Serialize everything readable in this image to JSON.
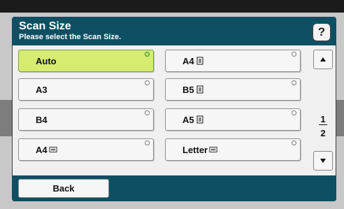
{
  "dialog": {
    "title": "Scan Size",
    "subtitle": "Please select the Scan Size."
  },
  "help_label": "?",
  "options": [
    {
      "label": "Auto",
      "selected": true,
      "icon": ""
    },
    {
      "label": "A4",
      "selected": false,
      "icon": "portrait-document-icon"
    },
    {
      "label": "A3",
      "selected": false,
      "icon": ""
    },
    {
      "label": "B5",
      "selected": false,
      "icon": "portrait-document-icon"
    },
    {
      "label": "B4",
      "selected": false,
      "icon": ""
    },
    {
      "label": "A5",
      "selected": false,
      "icon": "portrait-document-icon"
    },
    {
      "label": "A4",
      "selected": false,
      "icon": "landscape-document-icon"
    },
    {
      "label": "Letter",
      "selected": false,
      "icon": "landscape-document-icon"
    }
  ],
  "pagination": {
    "current": "1",
    "total": "2"
  },
  "footer": {
    "back_label": "Back"
  },
  "colors": {
    "header": "#0e4f63",
    "selected": "#d5ec70"
  }
}
